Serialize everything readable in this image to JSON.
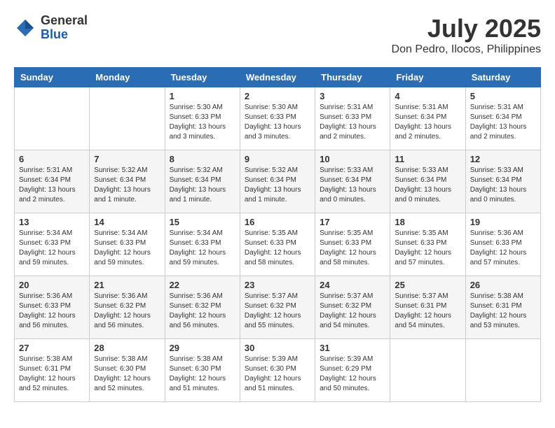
{
  "header": {
    "logo_general": "General",
    "logo_blue": "Blue",
    "month": "July 2025",
    "location": "Don Pedro, Ilocos, Philippines"
  },
  "days_of_week": [
    "Sunday",
    "Monday",
    "Tuesday",
    "Wednesday",
    "Thursday",
    "Friday",
    "Saturday"
  ],
  "weeks": [
    [
      {
        "day": "",
        "info": ""
      },
      {
        "day": "",
        "info": ""
      },
      {
        "day": "1",
        "info": "Sunrise: 5:30 AM\nSunset: 6:33 PM\nDaylight: 13 hours and 3 minutes."
      },
      {
        "day": "2",
        "info": "Sunrise: 5:30 AM\nSunset: 6:33 PM\nDaylight: 13 hours and 3 minutes."
      },
      {
        "day": "3",
        "info": "Sunrise: 5:31 AM\nSunset: 6:33 PM\nDaylight: 13 hours and 2 minutes."
      },
      {
        "day": "4",
        "info": "Sunrise: 5:31 AM\nSunset: 6:34 PM\nDaylight: 13 hours and 2 minutes."
      },
      {
        "day": "5",
        "info": "Sunrise: 5:31 AM\nSunset: 6:34 PM\nDaylight: 13 hours and 2 minutes."
      }
    ],
    [
      {
        "day": "6",
        "info": "Sunrise: 5:31 AM\nSunset: 6:34 PM\nDaylight: 13 hours and 2 minutes."
      },
      {
        "day": "7",
        "info": "Sunrise: 5:32 AM\nSunset: 6:34 PM\nDaylight: 13 hours and 1 minute."
      },
      {
        "day": "8",
        "info": "Sunrise: 5:32 AM\nSunset: 6:34 PM\nDaylight: 13 hours and 1 minute."
      },
      {
        "day": "9",
        "info": "Sunrise: 5:32 AM\nSunset: 6:34 PM\nDaylight: 13 hours and 1 minute."
      },
      {
        "day": "10",
        "info": "Sunrise: 5:33 AM\nSunset: 6:34 PM\nDaylight: 13 hours and 0 minutes."
      },
      {
        "day": "11",
        "info": "Sunrise: 5:33 AM\nSunset: 6:34 PM\nDaylight: 13 hours and 0 minutes."
      },
      {
        "day": "12",
        "info": "Sunrise: 5:33 AM\nSunset: 6:34 PM\nDaylight: 13 hours and 0 minutes."
      }
    ],
    [
      {
        "day": "13",
        "info": "Sunrise: 5:34 AM\nSunset: 6:33 PM\nDaylight: 12 hours and 59 minutes."
      },
      {
        "day": "14",
        "info": "Sunrise: 5:34 AM\nSunset: 6:33 PM\nDaylight: 12 hours and 59 minutes."
      },
      {
        "day": "15",
        "info": "Sunrise: 5:34 AM\nSunset: 6:33 PM\nDaylight: 12 hours and 59 minutes."
      },
      {
        "day": "16",
        "info": "Sunrise: 5:35 AM\nSunset: 6:33 PM\nDaylight: 12 hours and 58 minutes."
      },
      {
        "day": "17",
        "info": "Sunrise: 5:35 AM\nSunset: 6:33 PM\nDaylight: 12 hours and 58 minutes."
      },
      {
        "day": "18",
        "info": "Sunrise: 5:35 AM\nSunset: 6:33 PM\nDaylight: 12 hours and 57 minutes."
      },
      {
        "day": "19",
        "info": "Sunrise: 5:36 AM\nSunset: 6:33 PM\nDaylight: 12 hours and 57 minutes."
      }
    ],
    [
      {
        "day": "20",
        "info": "Sunrise: 5:36 AM\nSunset: 6:33 PM\nDaylight: 12 hours and 56 minutes."
      },
      {
        "day": "21",
        "info": "Sunrise: 5:36 AM\nSunset: 6:32 PM\nDaylight: 12 hours and 56 minutes."
      },
      {
        "day": "22",
        "info": "Sunrise: 5:36 AM\nSunset: 6:32 PM\nDaylight: 12 hours and 56 minutes."
      },
      {
        "day": "23",
        "info": "Sunrise: 5:37 AM\nSunset: 6:32 PM\nDaylight: 12 hours and 55 minutes."
      },
      {
        "day": "24",
        "info": "Sunrise: 5:37 AM\nSunset: 6:32 PM\nDaylight: 12 hours and 54 minutes."
      },
      {
        "day": "25",
        "info": "Sunrise: 5:37 AM\nSunset: 6:31 PM\nDaylight: 12 hours and 54 minutes."
      },
      {
        "day": "26",
        "info": "Sunrise: 5:38 AM\nSunset: 6:31 PM\nDaylight: 12 hours and 53 minutes."
      }
    ],
    [
      {
        "day": "27",
        "info": "Sunrise: 5:38 AM\nSunset: 6:31 PM\nDaylight: 12 hours and 52 minutes."
      },
      {
        "day": "28",
        "info": "Sunrise: 5:38 AM\nSunset: 6:30 PM\nDaylight: 12 hours and 52 minutes."
      },
      {
        "day": "29",
        "info": "Sunrise: 5:38 AM\nSunset: 6:30 PM\nDaylight: 12 hours and 51 minutes."
      },
      {
        "day": "30",
        "info": "Sunrise: 5:39 AM\nSunset: 6:30 PM\nDaylight: 12 hours and 51 minutes."
      },
      {
        "day": "31",
        "info": "Sunrise: 5:39 AM\nSunset: 6:29 PM\nDaylight: 12 hours and 50 minutes."
      },
      {
        "day": "",
        "info": ""
      },
      {
        "day": "",
        "info": ""
      }
    ]
  ]
}
